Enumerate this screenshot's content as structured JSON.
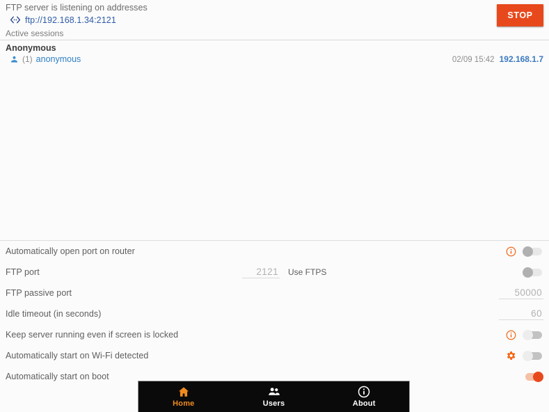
{
  "header": {
    "listening_text": "FTP server is listening on addresses",
    "address": "ftp://192.168.1.34:2121",
    "cast_icon": "cast-link-icon",
    "stop_label": "STOP"
  },
  "sessions": {
    "section_label": "Active sessions",
    "rows": [
      {
        "title": "Anonymous",
        "count": "(1)",
        "user": "anonymous",
        "time": "02/09 15:42",
        "ip": "192.168.1.7",
        "user_icon": "person-icon"
      }
    ]
  },
  "settings": {
    "rows": [
      {
        "label": "Automatically open port on router",
        "control": "toggle",
        "toggle_state": "off-dark",
        "info_icon": "info-icon"
      },
      {
        "label": "FTP port",
        "control": "input-with-ftps",
        "value": "2121",
        "ftps_label": "Use FTPS",
        "toggle_state": "off-dark"
      },
      {
        "label": "FTP passive port",
        "control": "input",
        "value": "50000"
      },
      {
        "label": "Idle timeout (in seconds)",
        "control": "input",
        "value": "60"
      },
      {
        "label": "Keep server running even if screen is locked",
        "control": "toggle",
        "toggle_state": "off-light",
        "info_icon": "info-icon"
      },
      {
        "label": "Automatically start on Wi-Fi detected",
        "control": "toggle",
        "toggle_state": "off-light",
        "gear_icon": "gear-icon"
      },
      {
        "label": "Automatically start on boot",
        "control": "toggle",
        "toggle_state": "on"
      }
    ]
  },
  "bottom_nav": {
    "items": [
      {
        "label": "Home",
        "icon": "home-icon",
        "active": true
      },
      {
        "label": "Users",
        "icon": "users-icon",
        "active": false
      },
      {
        "label": "About",
        "icon": "info-circle-icon",
        "active": false
      }
    ]
  },
  "colors": {
    "accent": "#e8491c",
    "nav_active": "#f08a1e",
    "link": "#2f5ca8",
    "session_link": "#2f7fc4",
    "nav_background": "#0a0a0a"
  }
}
